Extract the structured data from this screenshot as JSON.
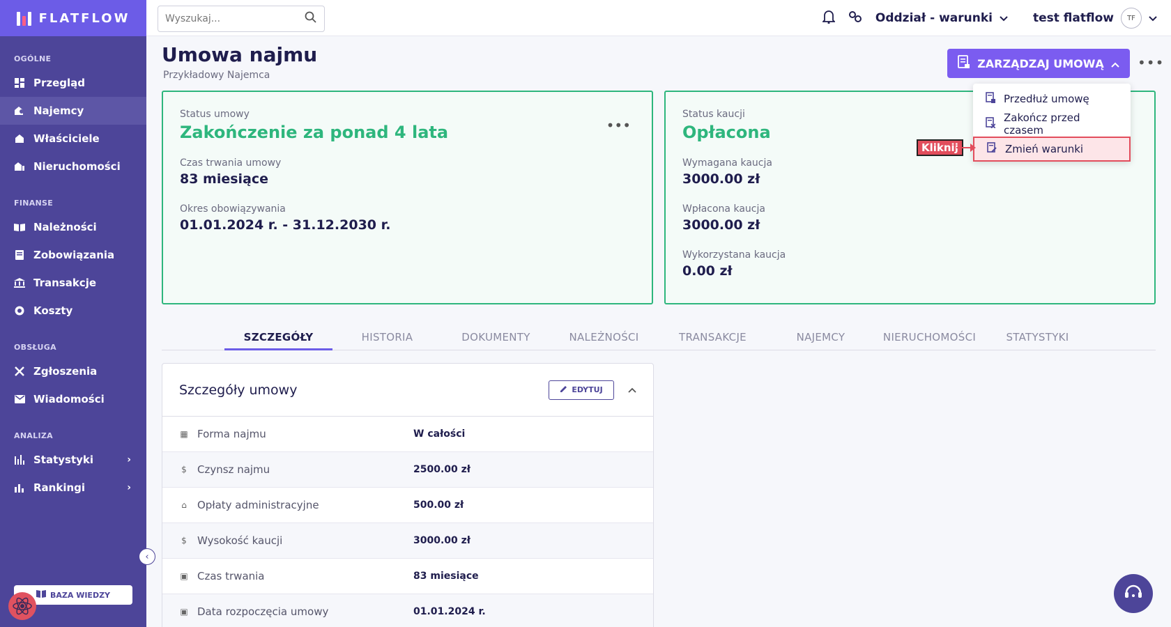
{
  "brand": {
    "name": "FLATFLOW"
  },
  "sidebar": {
    "sections": [
      {
        "label": "OGÓLNE",
        "items": [
          {
            "label": "Przegląd",
            "icon": "dashboard-icon",
            "active": false
          },
          {
            "label": "Najemcy",
            "icon": "tenants-icon",
            "active": true
          },
          {
            "label": "Właściciele",
            "icon": "owners-icon",
            "active": false
          },
          {
            "label": "Nieruchomości",
            "icon": "properties-icon",
            "active": false
          }
        ]
      },
      {
        "label": "FINANSE",
        "items": [
          {
            "label": "Należności",
            "icon": "receivables-icon"
          },
          {
            "label": "Zobowiązania",
            "icon": "liabilities-icon"
          },
          {
            "label": "Transakcje",
            "icon": "bank-icon"
          },
          {
            "label": "Koszty",
            "icon": "costs-icon"
          }
        ]
      },
      {
        "label": "OBSŁUGA",
        "items": [
          {
            "label": "Zgłoszenia",
            "icon": "tools-icon"
          },
          {
            "label": "Wiadomości",
            "icon": "mail-icon"
          }
        ]
      },
      {
        "label": "ANALIZA",
        "items": [
          {
            "label": "Statystyki",
            "icon": "stats-icon"
          },
          {
            "label": "Rankingi",
            "icon": "rankings-icon"
          }
        ]
      }
    ],
    "knowledge_base": "BAZA WIEDZY"
  },
  "topbar": {
    "search_placeholder": "Wyszukaj...",
    "branch": "Oddział - warunki",
    "user": "test flatflow",
    "avatar_initials": "TF"
  },
  "page": {
    "title": "Umowa najmu",
    "subtitle": "Przykładowy Najemca",
    "manage_button": "ZARZĄDZAJ UMOWĄ"
  },
  "dropdown": {
    "items": [
      "Przedłuż umowę",
      "Zakończ przed czasem",
      "Zmień warunki"
    ],
    "annotation": "Kliknij"
  },
  "contract_card": {
    "status_label": "Status umowy",
    "status_value": "Zakończenie za ponad 4 lata",
    "duration_label": "Czas trwania umowy",
    "duration_value": "83 miesiące",
    "period_label": "Okres obowiązywania",
    "period_value": "01.01.2024 r. - 31.12.2030 r."
  },
  "deposit_card": {
    "status_label": "Status kaucji",
    "status_value": "Opłacona",
    "required_label": "Wymagana kaucja",
    "required_value": "3000.00 zł",
    "paid_label": "Wpłacona kaucja",
    "paid_value": "3000.00 zł",
    "used_label": "Wykorzystana kaucja",
    "used_value": "0.00 zł"
  },
  "tabs": [
    "SZCZEGÓŁY",
    "HISTORIA",
    "DOKUMENTY",
    "NALEŻNOŚCI",
    "TRANSAKCJE",
    "NAJEMCY",
    "NIERUCHOMOŚCI",
    "STATYSTYKI"
  ],
  "details": {
    "title": "Szczegóły umowy",
    "edit_label": "EDYTUJ",
    "rows": [
      {
        "label": "Forma najmu",
        "value": "W całości",
        "icon": "building-icon"
      },
      {
        "label": "Czynsz najmu",
        "value": "2500.00 zł",
        "icon": "dollar-icon"
      },
      {
        "label": "Opłaty administracyjne",
        "value": "500.00 zł",
        "icon": "bank-icon"
      },
      {
        "label": "Wysokość kaucji",
        "value": "3000.00 zł",
        "icon": "dollar-icon"
      },
      {
        "label": "Czas trwania",
        "value": "83 miesiące",
        "icon": "calendar-icon"
      },
      {
        "label": "Data rozpoczęcia umowy",
        "value": "01.01.2024 r.",
        "icon": "calendar-icon"
      }
    ]
  }
}
